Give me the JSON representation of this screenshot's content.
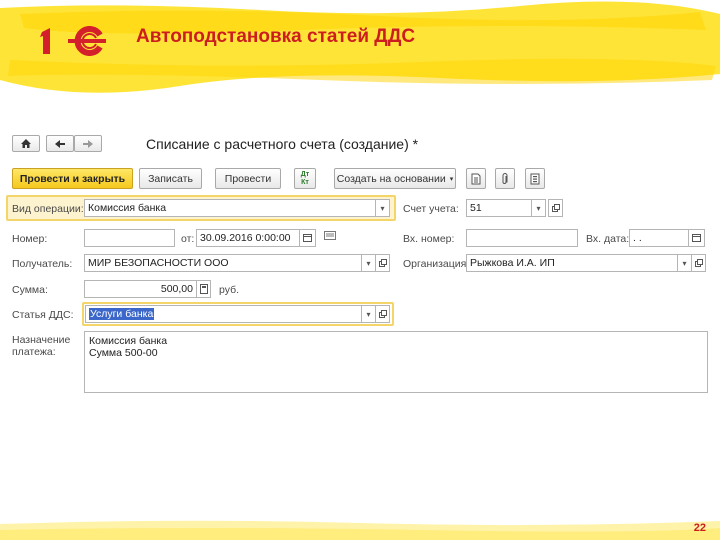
{
  "slide": {
    "title": "Автоподстановка статей ДДС",
    "page_number": "22",
    "colors": {
      "band": "#ffe227",
      "title": "#cc1e1e",
      "logo": "#d4202a"
    }
  },
  "logo": {
    "text": "1С",
    "icon": "1c-logo-icon"
  },
  "form": {
    "title": "Списание с расчетного счета (создание) *",
    "nav": {
      "home": "home-icon",
      "back": "arrow-left-icon",
      "forward": "arrow-right-icon"
    },
    "toolbar": {
      "post_close": "Провести и закрыть",
      "save": "Записать",
      "post": "Провести",
      "dtkt": "Дт Кт",
      "create_based": "Создать на основании",
      "icons": [
        "document-icon",
        "paperclip-icon",
        "report-icon"
      ]
    },
    "fields": {
      "operation_type": {
        "label": "Вид операции:",
        "value": "Комиссия банка"
      },
      "account": {
        "label": "Счет учета:",
        "value": "51"
      },
      "number": {
        "label": "Номер:",
        "value": ""
      },
      "date": {
        "label": "от:",
        "value": "30.09.2016  0:00:00"
      },
      "incoming_number": {
        "label": "Вх. номер:",
        "value": ""
      },
      "incoming_date": {
        "label": "Вх. дата:",
        "value": " .  ."
      },
      "recipient": {
        "label": "Получатель:",
        "value": "МИР БЕЗОПАСНОСТИ ООО"
      },
      "organization": {
        "label": "Организация:",
        "value": "Рыжкова И.А. ИП"
      },
      "amount": {
        "label": "Сумма:",
        "value": "500,00",
        "currency": "руб."
      },
      "cash_flow_item": {
        "label": "Статья ДДС:",
        "value": "Услуги банка"
      },
      "purpose": {
        "label_line1": "Назначение",
        "label_line2": "платежа:",
        "line1": "Комиссия банка",
        "line2": "Сумма 500-00"
      }
    }
  }
}
